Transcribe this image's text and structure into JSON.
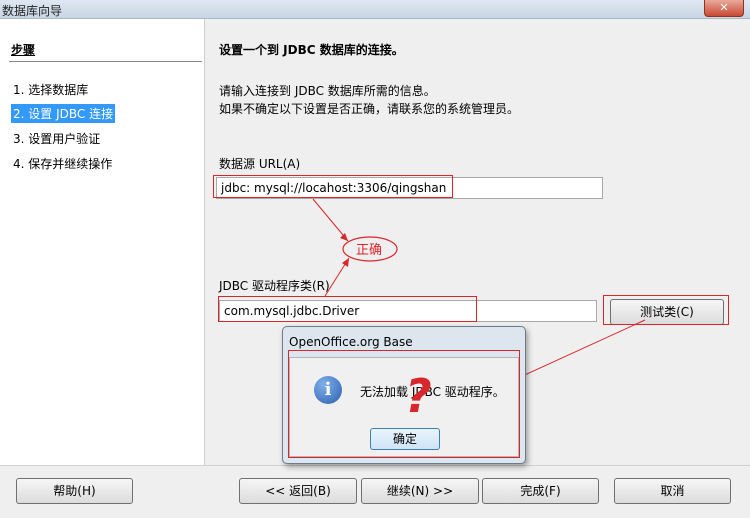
{
  "window": {
    "title": "数据库向导",
    "close_glyph": "✕"
  },
  "sidebar": {
    "heading": "步骤",
    "steps": [
      "1. 选择数据库",
      "2. 设置 JDBC 连接",
      "3. 设置用户验证",
      "4. 保存并继续操作"
    ],
    "active_index": 1
  },
  "main": {
    "heading": "设置一个到 JDBC 数据库的连接。",
    "desc_line1": "请输入连接到 JDBC 数据库所需的信息。",
    "desc_line2": "如果不确定以下设置是否正确，请联系您的系统管理员。",
    "url_label": "数据源 URL(A)",
    "url_value": "jdbc: mysql://locahost:3306/qingshan",
    "driver_label": "JDBC 驱动程序类(R)",
    "driver_value": "com.mysql.jdbc.Driver",
    "test_button": "测试类(C)"
  },
  "annotation": {
    "correct_text": "正确",
    "question_mark": "?"
  },
  "dialog": {
    "title": "OpenOffice.org Base",
    "message": "无法加载 JDBC 驱动程序。",
    "ok_button": "确定",
    "icon": "info-icon"
  },
  "buttons": {
    "help": "帮助(H)",
    "back": "<< 返回(B)",
    "next": "继续(N) >>",
    "finish": "完成(F)",
    "cancel": "取消"
  },
  "colors": {
    "annotation_red": "#d9262b",
    "selection_blue": "#3399ff"
  }
}
